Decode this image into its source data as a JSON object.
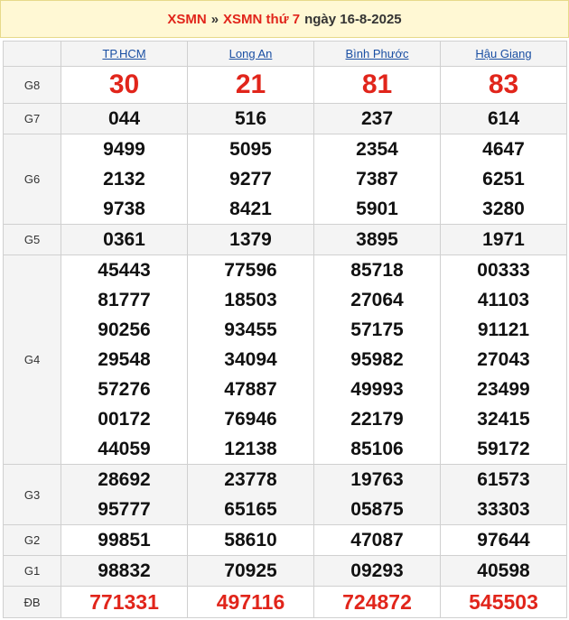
{
  "header": {
    "link1": "XSMN",
    "separator": "»",
    "link2": "XSMN thứ 7",
    "date_text": "ngày 16-8-2025"
  },
  "provinces": [
    "TP.HCM",
    "Long An",
    "Bình Phước",
    "Hậu Giang"
  ],
  "prizes": [
    {
      "label": "G8",
      "results": [
        [
          "30"
        ],
        [
          "21"
        ],
        [
          "81"
        ],
        [
          "83"
        ]
      ]
    },
    {
      "label": "G7",
      "results": [
        [
          "044"
        ],
        [
          "516"
        ],
        [
          "237"
        ],
        [
          "614"
        ]
      ]
    },
    {
      "label": "G6",
      "results": [
        [
          "9499",
          "2132",
          "9738"
        ],
        [
          "5095",
          "9277",
          "8421"
        ],
        [
          "2354",
          "7387",
          "5901"
        ],
        [
          "4647",
          "6251",
          "3280"
        ]
      ]
    },
    {
      "label": "G5",
      "results": [
        [
          "0361"
        ],
        [
          "1379"
        ],
        [
          "3895"
        ],
        [
          "1971"
        ]
      ]
    },
    {
      "label": "G4",
      "results": [
        [
          "45443",
          "81777",
          "90256",
          "29548",
          "57276",
          "00172",
          "44059"
        ],
        [
          "77596",
          "18503",
          "93455",
          "34094",
          "47887",
          "76946",
          "12138"
        ],
        [
          "85718",
          "27064",
          "57175",
          "95982",
          "49993",
          "22179",
          "85106"
        ],
        [
          "00333",
          "41103",
          "91121",
          "27043",
          "23499",
          "32415",
          "59172"
        ]
      ]
    },
    {
      "label": "G3",
      "results": [
        [
          "28692",
          "95777"
        ],
        [
          "23778",
          "65165"
        ],
        [
          "19763",
          "05875"
        ],
        [
          "61573",
          "33303"
        ]
      ]
    },
    {
      "label": "G2",
      "results": [
        [
          "99851"
        ],
        [
          "58610"
        ],
        [
          "47087"
        ],
        [
          "97644"
        ]
      ]
    },
    {
      "label": "G1",
      "results": [
        [
          "98832"
        ],
        [
          "70925"
        ],
        [
          "09293"
        ],
        [
          "40598"
        ]
      ]
    },
    {
      "label": "ĐB",
      "results": [
        [
          "771331"
        ],
        [
          "497116"
        ],
        [
          "724872"
        ],
        [
          "545503"
        ]
      ]
    }
  ]
}
